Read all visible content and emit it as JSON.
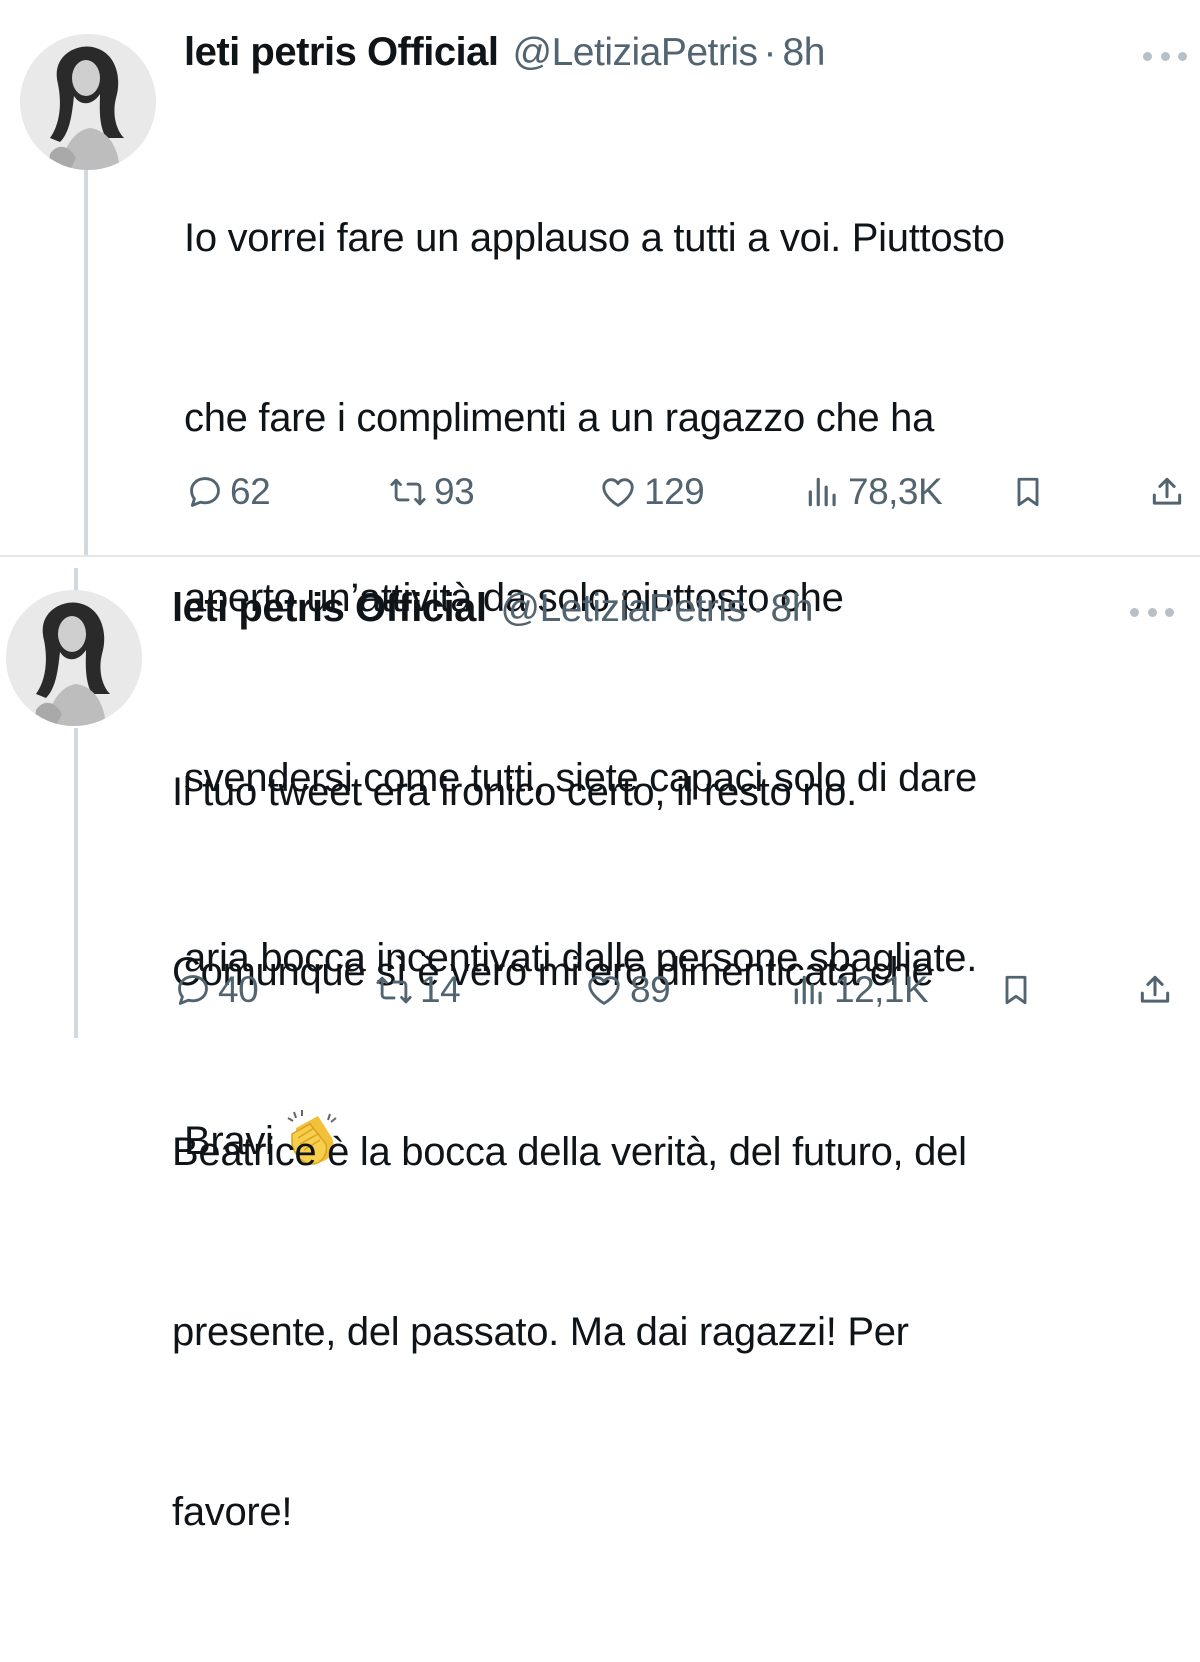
{
  "tweets": [
    {
      "author_name": "leti petris Official",
      "handle": "@LetiziaPetris",
      "separator": "·",
      "time": "8h",
      "text_lines": [
        "Io vorrei fare un applauso a tutti a voi. Piuttosto",
        "che fare i complimenti a un ragazzo che ha",
        "aperto un’attività da solo piuttosto che",
        "svendersi come tutti, siete capaci solo di dare",
        "aria bocca incentivati dalle persone sbagliate.",
        "Bravi"
      ],
      "emoji": "clapping-hands",
      "replies": "62",
      "reposts": "93",
      "likes": "129",
      "views": "78,3K"
    },
    {
      "author_name": "leti petris Official",
      "handle": "@LetiziaPetris",
      "separator": "·",
      "time": "8h",
      "text_lines": [
        "Il tuo tweet era ironico certo, il resto no.",
        "Comunque sì è vero mi ero dimenticata che",
        "Beatrice è la bocca della verità, del futuro, del",
        "presente, del passato. Ma dai ragazzi! Per",
        "favore!"
      ],
      "replies": "40",
      "reposts": "14",
      "likes": "89",
      "views": "12,1K"
    }
  ],
  "colors": {
    "text": "#0f1419",
    "secondary": "#536471",
    "thread_line": "#cfd9de",
    "divider": "#e4e6e8"
  }
}
